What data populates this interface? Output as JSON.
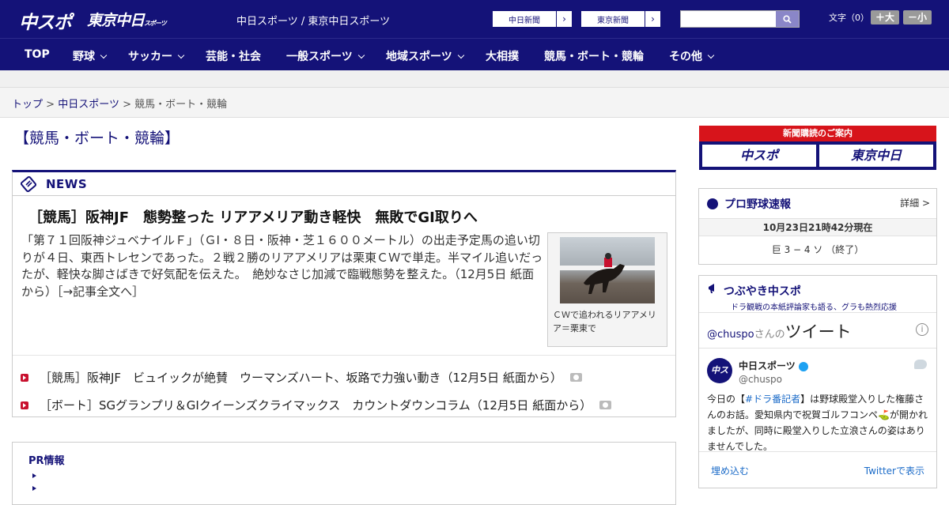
{
  "header": {
    "logo1": "中スポ",
    "logo2": "東京中日",
    "logo2_sub": "スポーツ",
    "site_name": "中日スポーツ / 東京中日スポーツ",
    "paper1": "中日新聞",
    "paper2": "東京新聞",
    "font_label": "文字（0）",
    "font_bigger": "＋大",
    "font_smaller": "－小"
  },
  "nav": {
    "items": [
      "TOP",
      "野球",
      "サッカー",
      "芸能・社会",
      "一般スポーツ",
      "地域スポーツ",
      "大相撲",
      "競馬・ボート・競輪",
      "その他"
    ]
  },
  "breadcrumb": {
    "top": "トップ",
    "sep": ">",
    "mid": "中日スポーツ",
    "current": "競馬・ボート・競輪"
  },
  "page_title": "【競馬・ボート・競輪】",
  "news": {
    "label": "NEWS",
    "headline": "［競馬］阪神JF　態勢整った リアアメリア動き軽快　無敗でGI取りへ",
    "body": "「第７１回阪神ジュベナイルＦ」（ＧⅠ・８日・阪神・芝１６００メートル）の出走予定馬の追い切りが４日、東西トレセンであった。２戦２勝のリアアメリアは栗東ＣＷで単走。半マイル追いだったが、軽快な脚さばきで好気配を伝えた。　絶妙なさじ加減で臨戦態勢を整えた。（12月5日 紙面から）［→記事全文へ］",
    "photo_caption": "ＣＷで追われるリアアメリア＝栗東で",
    "items": [
      "［競馬］阪神JF　ビュイックが絶賛　ウーマンズハート、坂路で力強い動き（12月5日 紙面から）",
      "［ボート］SGグランプリ＆GIクイーンズクライマックス　カウントダウンコラム（12月5日 紙面から）"
    ]
  },
  "pr": {
    "title": "PR情報"
  },
  "subscribe": {
    "title": "新聞購読のご案内",
    "btn1": "中スポ",
    "btn2": "東京中日"
  },
  "baseball": {
    "title": "プロ野球速報",
    "more": "詳細 >",
    "time": "10月23日21時42分現在",
    "score": "巨 3 − 4 ソ （終了）"
  },
  "tweets": {
    "title": "つぶやき中スポ",
    "subtitle": "ドラ観戦の本紙評論家も語る、グラも熱烈応援",
    "handle_link": "@chuspo",
    "handle_suffix": "さんの",
    "tweet_word": "ツイート",
    "account_name": "中日スポーツ",
    "account_handle": "@chuspo",
    "text_pre": "今日の【",
    "hashtag": "#ドラ番記者",
    "text_post": "】は野球殿堂入りした権藤さんのお話。愛知県内で祝賀ゴルフコンペ⛳が開かれましたが、同時に殿堂入りした立浪さんの姿はありませんでした。",
    "embed": "埋め込む",
    "view": "Twitterで表示"
  },
  "colors": {
    "brand": "#141278",
    "accent": "#d7141b"
  }
}
